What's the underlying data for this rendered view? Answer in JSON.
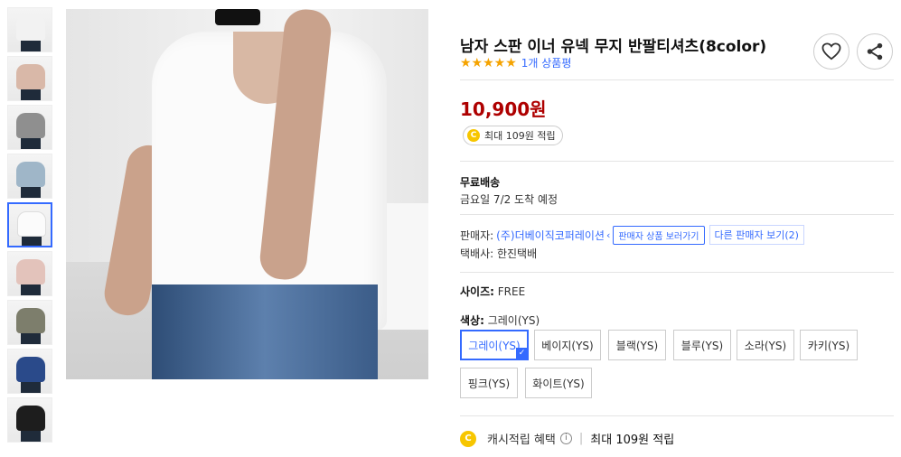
{
  "product": {
    "title": "남자 스판 이너 유넥 무지 반팔티셔츠(8color)",
    "stars": "★★★★★",
    "review_link": "1개 상품평",
    "price": "10,900원",
    "cash_badge": "최대 109원 적립",
    "coin_symbol": "C"
  },
  "shipping": {
    "title": "무료배송",
    "date": "금요일 7/2 도착 예정"
  },
  "seller": {
    "label": "판매자:",
    "name": "(주)더베이직코퍼레이션",
    "view_products_button": "판매자 상품 보러가기",
    "other_sellers_button": "다른 판매자 보기(2)",
    "courier": "택배사: 한진택배"
  },
  "size": {
    "label": "사이즈:",
    "value": "FREE"
  },
  "color": {
    "label": "색상:",
    "value": "그레이(YS)",
    "options": [
      "그레이(YS)",
      "베이지(YS)",
      "블랙(YS)",
      "블루(YS)",
      "소라(YS)",
      "카키(YS)",
      "핑크(YS)",
      "화이트(YS)"
    ]
  },
  "benefit": {
    "label": "캐시적립 혜택",
    "info_glyph": "i",
    "separator": "|",
    "value": "최대 109원 적립"
  },
  "thumbnail_colors": [
    "#f2f2f2",
    "#d9b8a8",
    "#8f8f8f",
    "#9fb6c8",
    "#fbfbfb",
    "#e3c3bb",
    "#7d7e6c",
    "#2a4a8a",
    "#1d1d1d"
  ],
  "colors": {
    "accent": "#346aff",
    "price": "#ae0000",
    "star": "#f5a300"
  },
  "icons": {
    "heart": "heart-icon",
    "share": "share-icon",
    "check": "check-icon"
  }
}
